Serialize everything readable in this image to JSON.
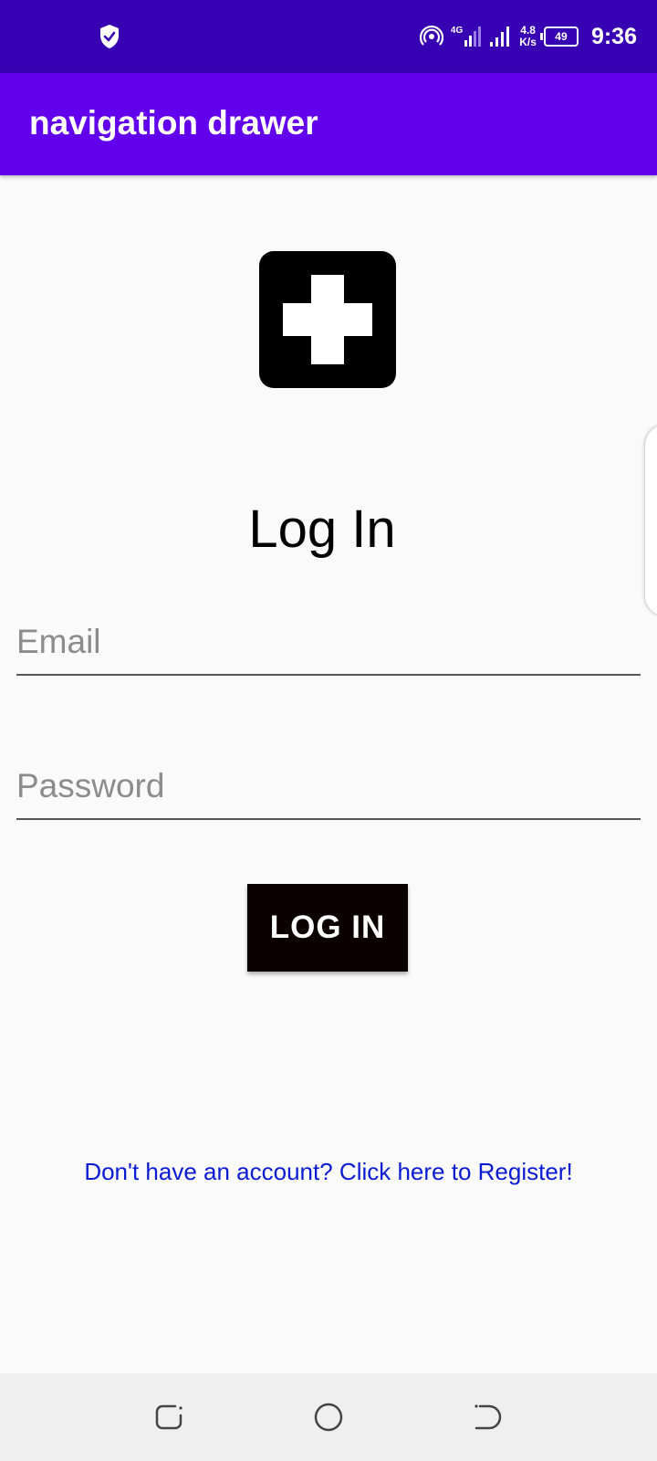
{
  "status_bar": {
    "time": "9:36",
    "battery_level": "49",
    "network_type": "4G",
    "speed_value": "4.8",
    "speed_unit": "K/s",
    "icons": [
      "shield-check-icon",
      "hotspot-icon",
      "signal-4g-icon",
      "signal-icon",
      "battery-icon"
    ]
  },
  "app_bar": {
    "title": "navigation drawer",
    "color": "#6200ee"
  },
  "logo": {
    "icon": "medical-cross-icon"
  },
  "form": {
    "heading": "Log In",
    "email_placeholder": "Email",
    "password_placeholder": "Password",
    "login_button": "LOG IN"
  },
  "register_link": "Don't have an account? Click here to Register!",
  "nav_bar": {
    "icons": [
      "recent-apps-icon",
      "home-icon",
      "back-icon"
    ]
  },
  "colors": {
    "status_bar": "#3700b3",
    "app_bar": "#6200ee",
    "button": "#0b0000",
    "link": "#0b1bd1",
    "background": "#fafafa"
  }
}
